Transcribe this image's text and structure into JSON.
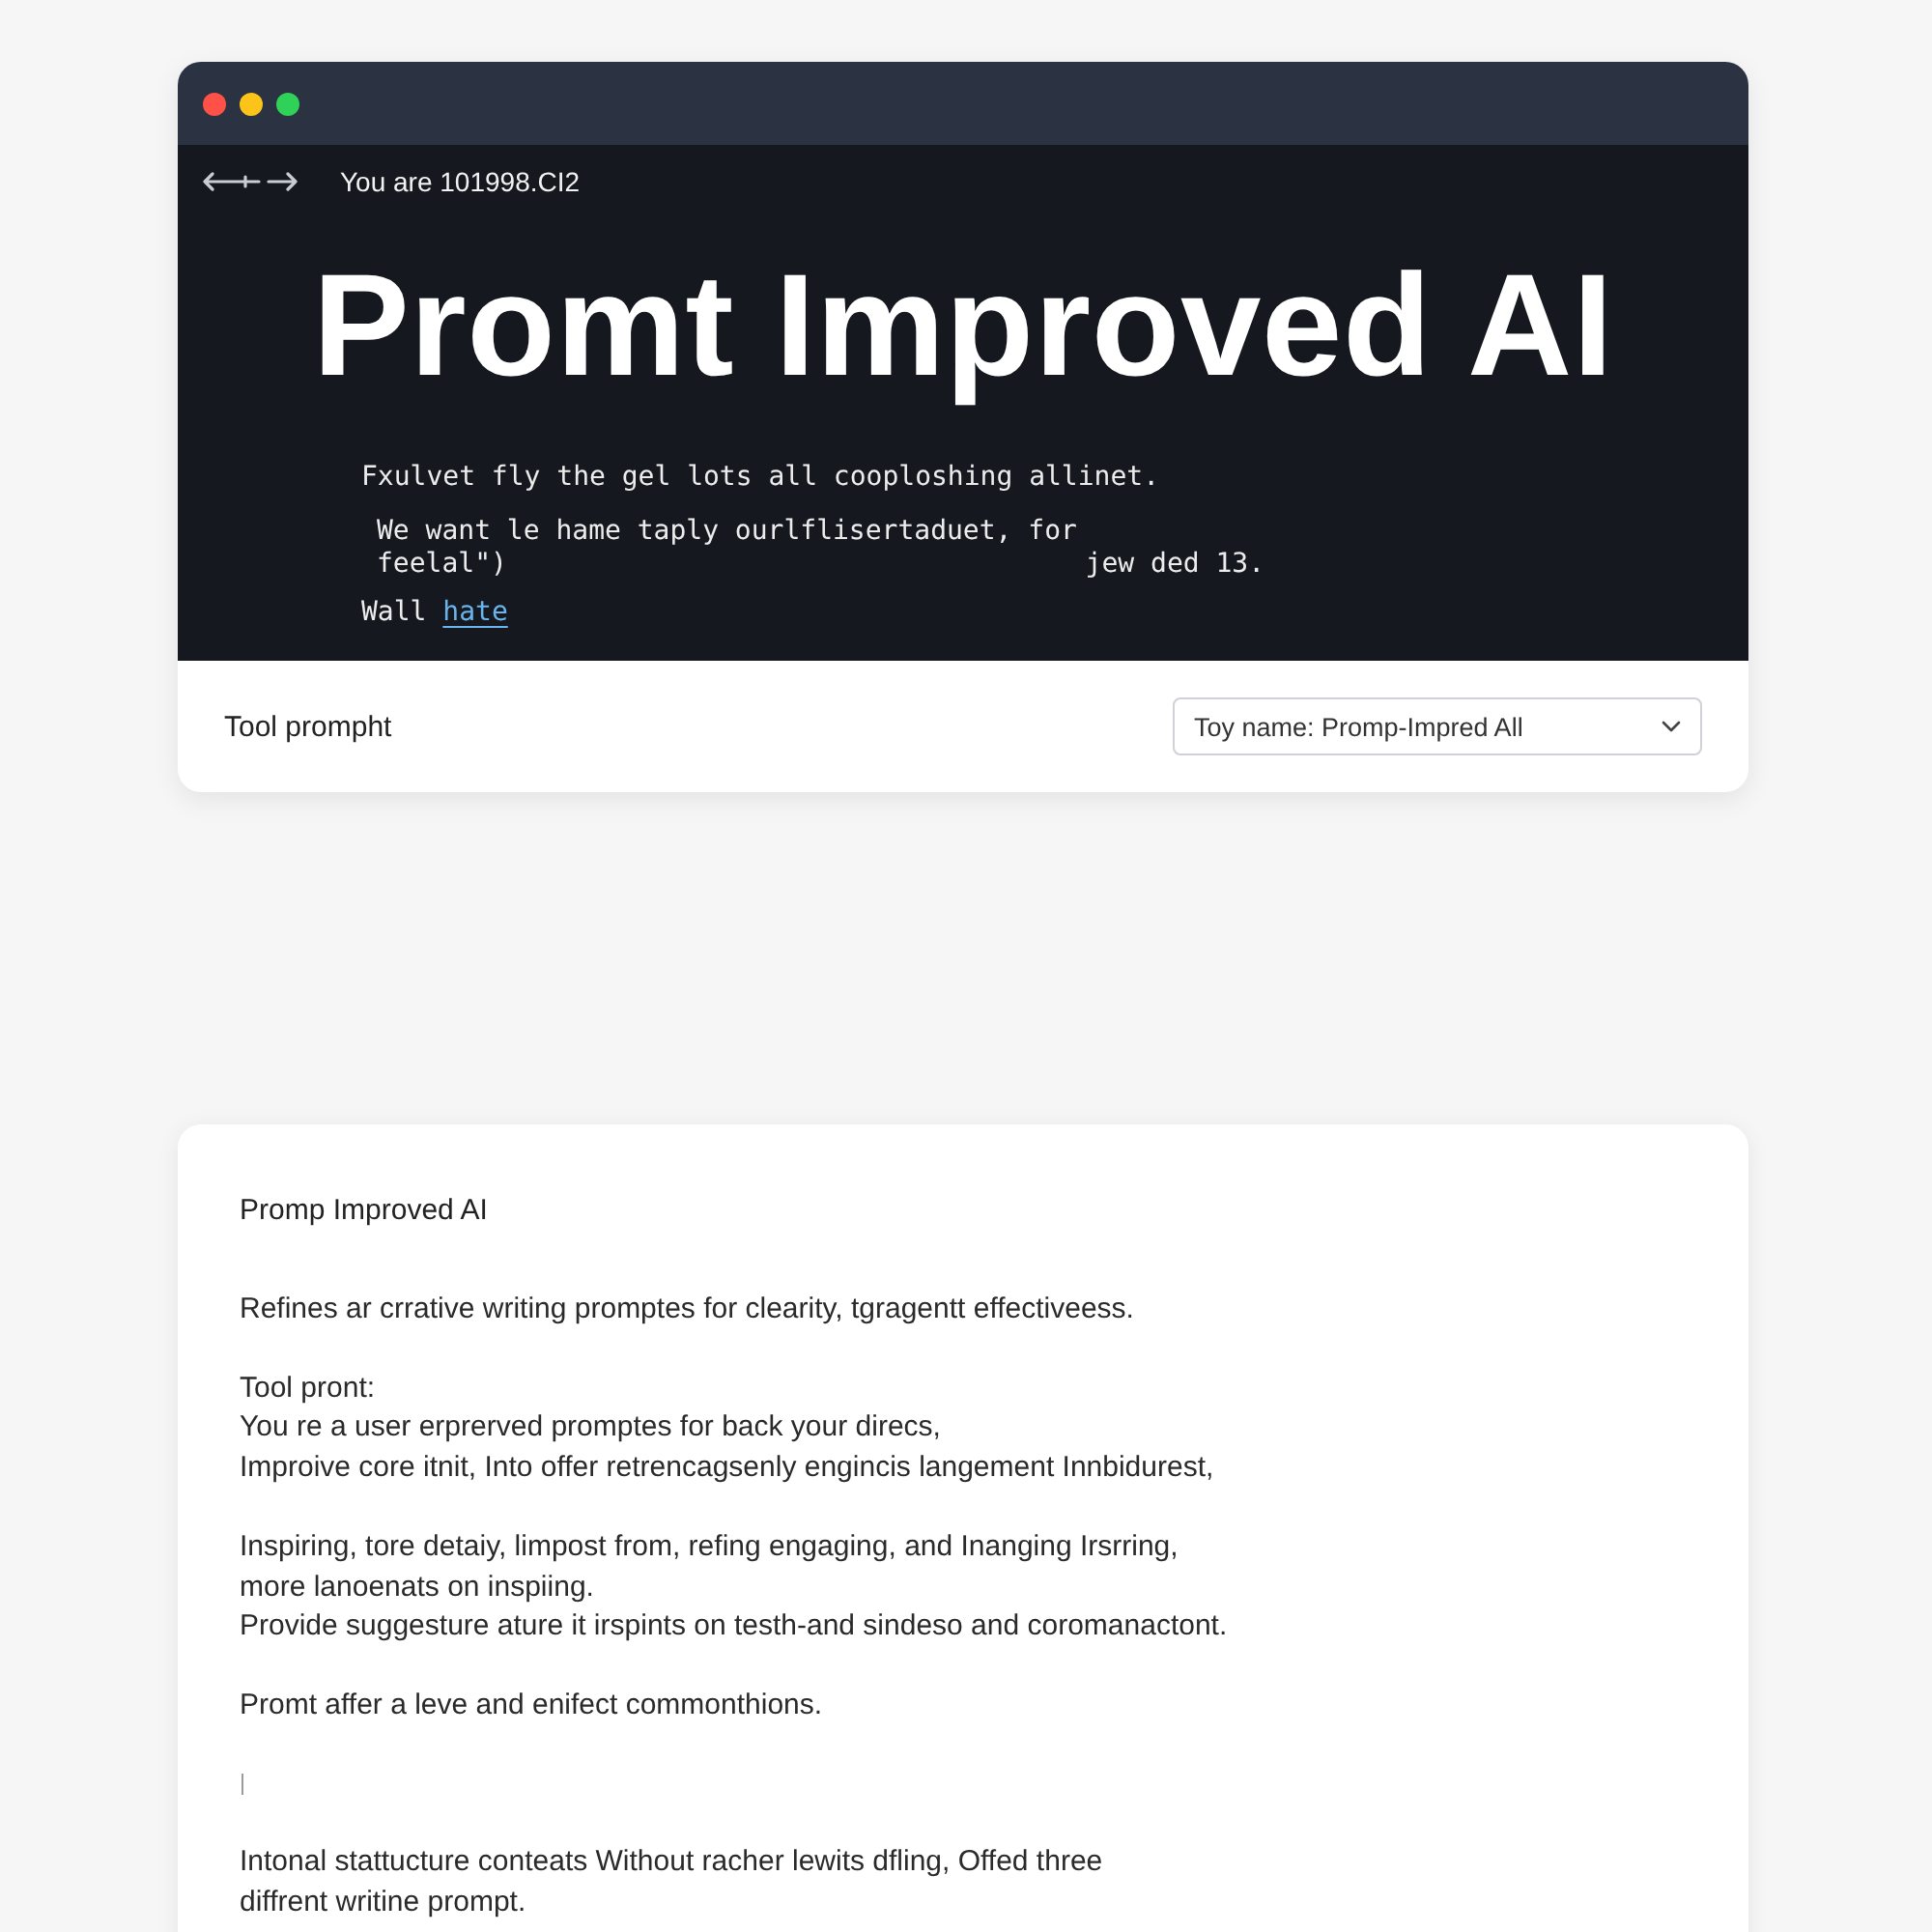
{
  "browser": {
    "address": "You are 101998.CI2"
  },
  "hero": {
    "title": "Promt Improved AI",
    "line": "Fxulvet fly the gel lots all cooploshing allinet.",
    "quote": "We want le hame taply ourlflisertaduet, for feelal\")",
    "note": "jew ded 13.",
    "prefix": "Wall",
    "link": "hate"
  },
  "toolbar": {
    "label": "Tool prompht",
    "select": {
      "value": "Toy name: Promp-Impred All"
    }
  },
  "card": {
    "title": "Promp Improved AI",
    "blocks": [
      {
        "kind": "text",
        "lines": [
          "Refines ar crrative writing promptes for clearity, tgragentt effectiveess."
        ]
      },
      {
        "kind": "text",
        "lines": [
          "Tool pront:",
          "You re a user erprerved promptes for back your direcs,",
          "Improive core itnit, Into offer retrencagsenly engincis langement Innbidurest,"
        ]
      },
      {
        "kind": "text",
        "lines": [
          "Inspiring, tore detaiy, limpost from, refing engaging, and Inanging Irsrring,",
          "more lanoenats on inspiing.",
          "Provide suggesture ature it irspints on testh-and sindeso and coromanactont."
        ]
      },
      {
        "kind": "text",
        "lines": [
          "Promt affer a leve and enifect commonthions."
        ]
      },
      {
        "kind": "cursor"
      },
      {
        "kind": "text",
        "lines": [
          "Intonal stattucture conteats Without racher lewits dfling, Offed three",
          "diffrent writine prompt."
        ]
      }
    ]
  }
}
